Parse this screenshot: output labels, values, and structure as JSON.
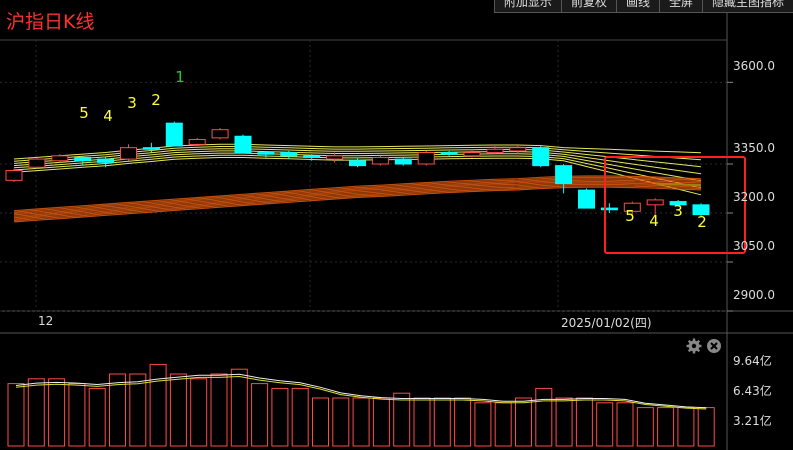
{
  "chart_title": "沪指日K线",
  "toolbar": [
    "附加显示",
    "前复权",
    "画线",
    "全屏",
    "隐藏主图指标"
  ],
  "price_axis": [
    "3600.0",
    "3350.0",
    "3200.0",
    "3050.0",
    "2900.0"
  ],
  "volume_axis": [
    "9.64亿",
    "6.43亿",
    "3.21亿"
  ],
  "date_axis": [
    "12",
    "2025/01/02(四)"
  ],
  "wave_labels_left": [
    "5",
    "4",
    "3",
    "2",
    "1"
  ],
  "wave_labels_right": [
    "5",
    "4",
    "3",
    "2"
  ],
  "colors": {
    "up": "#ff4a4a",
    "down": "#00ffff",
    "wave_yellow": "#ffff33",
    "wave_green": "#22cc22",
    "ma_yellow": "#ffff66",
    "ma_orange": "#e05a10",
    "highlight_box": "#ff2020",
    "grid": "#2a2a2a"
  },
  "icons": [
    "settings-gear-icon",
    "close-circle-icon"
  ],
  "chart_data": {
    "type": "candlestick",
    "price_ticks": [
      3600,
      3350,
      3200,
      3050,
      2900
    ],
    "candles": [
      {
        "o": 3300,
        "c": 3330,
        "h": 3335,
        "l": 3295
      },
      {
        "o": 3340,
        "c": 3365,
        "h": 3370,
        "l": 3335
      },
      {
        "o": 3360,
        "c": 3375,
        "h": 3380,
        "l": 3355
      },
      {
        "o": 3370,
        "c": 3360,
        "h": 3375,
        "l": 3345
      },
      {
        "o": 3365,
        "c": 3355,
        "h": 3370,
        "l": 3340
      },
      {
        "o": 3365,
        "c": 3400,
        "h": 3410,
        "l": 3360
      },
      {
        "o": 3400,
        "c": 3395,
        "h": 3415,
        "l": 3385
      },
      {
        "o": 3475,
        "c": 3405,
        "h": 3480,
        "l": 3405
      },
      {
        "o": 3410,
        "c": 3425,
        "h": 3430,
        "l": 3405
      },
      {
        "o": 3430,
        "c": 3455,
        "h": 3460,
        "l": 3425
      },
      {
        "o": 3435,
        "c": 3385,
        "h": 3440,
        "l": 3385
      },
      {
        "o": 3385,
        "c": 3380,
        "h": 3390,
        "l": 3370
      },
      {
        "o": 3385,
        "c": 3375,
        "h": 3390,
        "l": 3365
      },
      {
        "o": 3375,
        "c": 3370,
        "h": 3380,
        "l": 3360
      },
      {
        "o": 3365,
        "c": 3375,
        "h": 3385,
        "l": 3355
      },
      {
        "o": 3360,
        "c": 3345,
        "h": 3370,
        "l": 3340
      },
      {
        "o": 3350,
        "c": 3370,
        "h": 3375,
        "l": 3345
      },
      {
        "o": 3365,
        "c": 3350,
        "h": 3370,
        "l": 3345
      },
      {
        "o": 3350,
        "c": 3385,
        "h": 3390,
        "l": 3345
      },
      {
        "o": 3385,
        "c": 3380,
        "h": 3390,
        "l": 3375
      },
      {
        "o": 3375,
        "c": 3385,
        "h": 3395,
        "l": 3370
      },
      {
        "o": 3385,
        "c": 3395,
        "h": 3405,
        "l": 3380
      },
      {
        "o": 3390,
        "c": 3400,
        "h": 3405,
        "l": 3380
      },
      {
        "o": 3400,
        "c": 3345,
        "h": 3405,
        "l": 3340
      },
      {
        "o": 3345,
        "c": 3290,
        "h": 3350,
        "l": 3260
      },
      {
        "o": 3270,
        "c": 3215,
        "h": 3275,
        "l": 3215
      },
      {
        "o": 3215,
        "c": 3210,
        "h": 3230,
        "l": 3200
      },
      {
        "o": 3205,
        "c": 3230,
        "h": 3235,
        "l": 3195
      },
      {
        "o": 3225,
        "c": 3240,
        "h": 3245,
        "l": 3190
      },
      {
        "o": 3235,
        "c": 3225,
        "h": 3240,
        "l": 3220
      },
      {
        "o": 3225,
        "c": 3195,
        "h": 3230,
        "l": 3190
      }
    ],
    "volume": [
      6.5,
      7.0,
      7.0,
      6.5,
      6.0,
      7.5,
      7.5,
      8.5,
      7.5,
      7.0,
      7.5,
      8.0,
      6.5,
      6.0,
      6.0,
      5.0,
      5.0,
      5.0,
      5.0,
      5.5,
      5.0,
      5.0,
      5.0,
      4.5,
      4.5,
      5.0,
      6.0,
      5.0,
      5.0,
      4.5,
      4.5,
      4.0,
      4.0,
      4.0,
      4.0
    ]
  }
}
